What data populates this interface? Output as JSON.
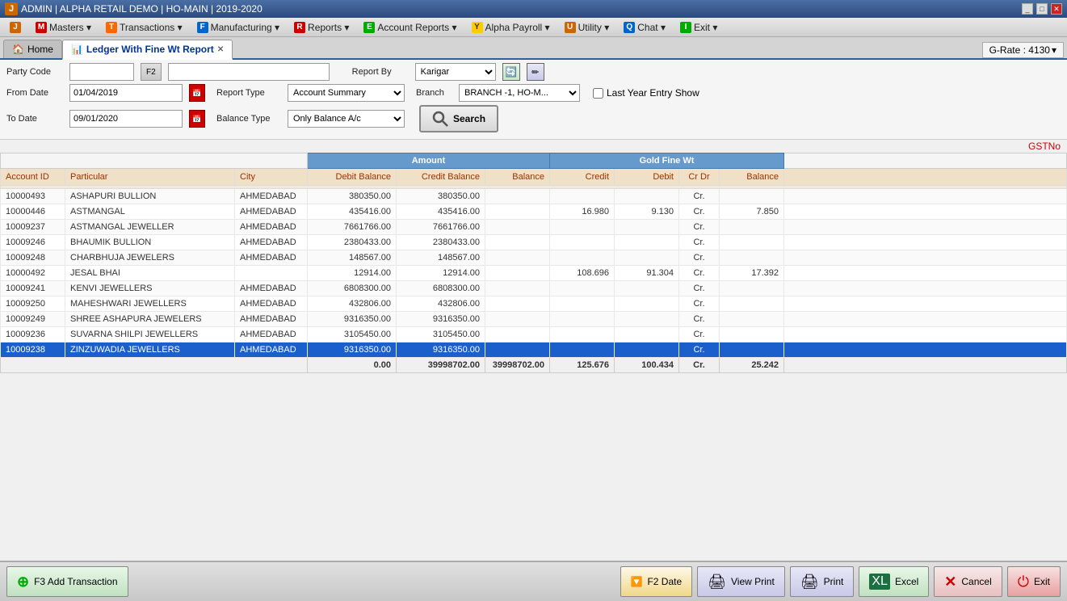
{
  "titleBar": {
    "appName": "J",
    "adminInfo": "ADMIN | ALPHA RETAIL DEMO | HO-MAIN | 2019-2020",
    "windowControls": [
      "_",
      "□",
      "✕"
    ]
  },
  "menuBar": {
    "items": [
      {
        "icon": "J",
        "iconColor": "#cc6600",
        "label": ""
      },
      {
        "icon": "M",
        "iconColor": "#cc0000",
        "label": "Masters"
      },
      {
        "icon": "T",
        "iconColor": "#ff6600",
        "label": "Transactions"
      },
      {
        "icon": "F",
        "iconColor": "#0066cc",
        "label": "Manufacturing"
      },
      {
        "icon": "R",
        "iconColor": "#cc0000",
        "label": "Reports"
      },
      {
        "icon": "E",
        "iconColor": "#00aa00",
        "label": "Account Reports"
      },
      {
        "icon": "Y",
        "iconColor": "#ffcc00",
        "label": "Alpha Payroll"
      },
      {
        "icon": "U",
        "iconColor": "#cc6600",
        "label": "Utility"
      },
      {
        "icon": "Q",
        "iconColor": "#0066cc",
        "label": "Chat"
      },
      {
        "icon": "I",
        "iconColor": "#00aa00",
        "label": "Exit"
      }
    ]
  },
  "tabs": {
    "home": "Home",
    "active": "Ledger With Fine Wt Report",
    "grate": "G-Rate : 4130"
  },
  "form": {
    "partyCodeLabel": "Party Code",
    "partyCodeValue": "",
    "f2ButtonLabel": "F2",
    "reportByLabel": "Report By",
    "reportByValue": "Karigar",
    "fromDateLabel": "From Date",
    "fromDateValue": "01/04/2019",
    "reportTypeLabel": "Report Type",
    "reportTypeValue": "Account Summary",
    "branchLabel": "Branch",
    "branchValue": "BRANCH -1, HO-M...",
    "lastYearLabel": "Last Year Entry Show",
    "toDateLabel": "To Date",
    "toDateValue": "09/01/2020",
    "balanceTypeLabel": "Balance Type",
    "balanceTypeValue": "Only Balance A/c",
    "searchLabel": "Search"
  },
  "gstLabel": "GSTNo",
  "tableHeaders": {
    "group1Label": "Amount",
    "group2Label": "Gold Fine Wt",
    "col1": "Account ID",
    "col2": "Particular",
    "col3": "City",
    "col4": "Debit Balance",
    "col5": "Credit Balance",
    "col6": "Balance",
    "col7": "Credit",
    "col8": "Debit",
    "col9": "Cr Dr",
    "col10": "Balance"
  },
  "tableRows": [
    {
      "accountId": "10000493",
      "particular": "ASHAPURI BULLION",
      "city": "AHMEDABAD",
      "debitBalance": "380350.00",
      "creditBalance": "380350.00",
      "balance": "",
      "credit": "",
      "debit": "",
      "crDr": "Cr.",
      "goldBalance": "",
      "selected": false
    },
    {
      "accountId": "10000446",
      "particular": "ASTMANGAL",
      "city": "AHMEDABAD",
      "debitBalance": "435416.00",
      "creditBalance": "435416.00",
      "balance": "",
      "credit": "16.980",
      "debit": "9.130",
      "crDr": "Cr.",
      "goldBalance": "7.850",
      "selected": false
    },
    {
      "accountId": "10009237",
      "particular": "ASTMANGAL JEWELLER",
      "city": "AHMEDABAD",
      "debitBalance": "7661766.00",
      "creditBalance": "7661766.00",
      "balance": "",
      "credit": "",
      "debit": "",
      "crDr": "Cr.",
      "goldBalance": "",
      "selected": false
    },
    {
      "accountId": "10009246",
      "particular": "BHAUMIK BULLION",
      "city": "AHMEDABAD",
      "debitBalance": "2380433.00",
      "creditBalance": "2380433.00",
      "balance": "",
      "credit": "",
      "debit": "",
      "crDr": "Cr.",
      "goldBalance": "",
      "selected": false
    },
    {
      "accountId": "10009248",
      "particular": "CHARBHUJA JEWELERS",
      "city": "AHMEDABAD",
      "debitBalance": "148567.00",
      "creditBalance": "148567.00",
      "balance": "",
      "credit": "",
      "debit": "",
      "crDr": "Cr.",
      "goldBalance": "",
      "selected": false
    },
    {
      "accountId": "10000492",
      "particular": "JESAL BHAI",
      "city": "",
      "debitBalance": "12914.00",
      "creditBalance": "12914.00",
      "balance": "",
      "credit": "108.696",
      "debit": "91.304",
      "crDr": "Cr.",
      "goldBalance": "17.392",
      "selected": false
    },
    {
      "accountId": "10009241",
      "particular": "KENVI JEWELLERS",
      "city": "AHMEDABAD",
      "debitBalance": "6808300.00",
      "creditBalance": "6808300.00",
      "balance": "",
      "credit": "",
      "debit": "",
      "crDr": "Cr.",
      "goldBalance": "",
      "selected": false
    },
    {
      "accountId": "10009250",
      "particular": "MAHESHWARI JEWELLERS",
      "city": "AHMEDABAD",
      "debitBalance": "432806.00",
      "creditBalance": "432806.00",
      "balance": "",
      "credit": "",
      "debit": "",
      "crDr": "Cr.",
      "goldBalance": "",
      "selected": false
    },
    {
      "accountId": "10009249",
      "particular": "SHREE ASHAPURA JEWELERS",
      "city": "AHMEDABAD",
      "debitBalance": "9316350.00",
      "creditBalance": "9316350.00",
      "balance": "",
      "credit": "",
      "debit": "",
      "crDr": "Cr.",
      "goldBalance": "",
      "selected": false
    },
    {
      "accountId": "10009236",
      "particular": "SUVARNA SHILPI JEWELLERS",
      "city": "AHMEDABAD",
      "debitBalance": "3105450.00",
      "creditBalance": "3105450.00",
      "balance": "",
      "credit": "",
      "debit": "",
      "crDr": "Cr.",
      "goldBalance": "",
      "selected": false
    },
    {
      "accountId": "10009238",
      "particular": "ZINZUWADIA JEWELLERS",
      "city": "AHMEDABAD",
      "debitBalance": "9316350.00",
      "creditBalance": "9316350.00",
      "balance": "",
      "credit": "",
      "debit": "",
      "crDr": "Cr.",
      "goldBalance": "",
      "selected": true
    }
  ],
  "summaryRow": {
    "debitBalance": "0.00",
    "creditBalance": "39998702.00",
    "balance": "39998702.00",
    "credit": "125.676",
    "debit": "100.434",
    "crDr": "Cr.",
    "goldBalance": "25.242"
  },
  "footer": {
    "addTransactionLabel": "F3 Add Transaction",
    "f2DateLabel": "F2 Date",
    "viewPrintLabel": "View Print",
    "printLabel": "Print",
    "excelLabel": "Excel",
    "cancelLabel": "Cancel",
    "exitLabel": "Exit"
  }
}
